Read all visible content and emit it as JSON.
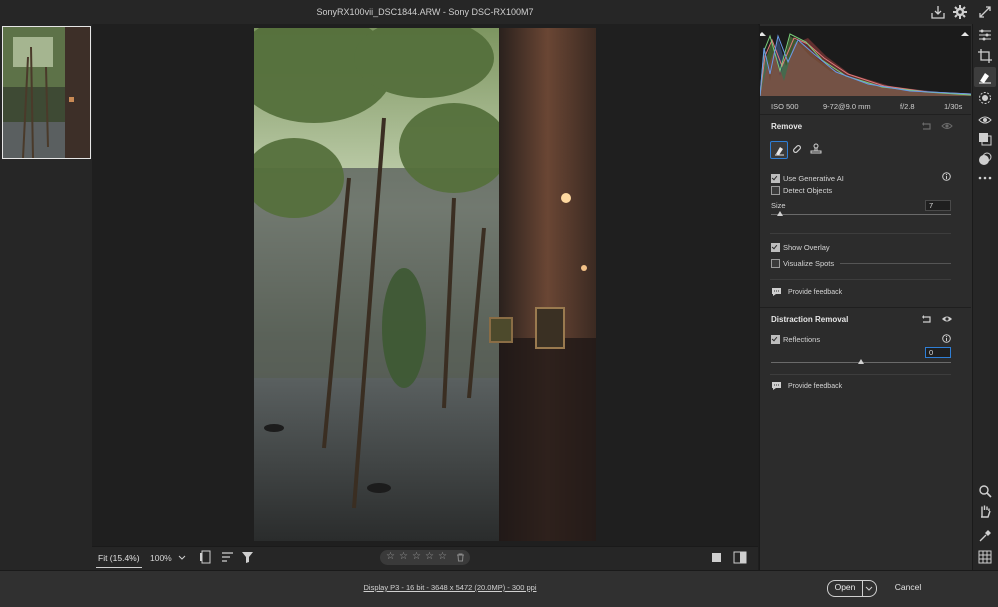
{
  "window": {
    "title": "SonyRX100vii_DSC1844.ARW  -  Sony DSC-RX100M7"
  },
  "canvas_toolbar": {
    "fit_label": "Fit (15.4%)",
    "zoom_label": "100%",
    "rating_stars": [
      "☆",
      "☆",
      "☆",
      "☆",
      "☆"
    ]
  },
  "footer": {
    "info": "Display P3 - 16 bit - 3648 x 5472 (20.0MP) - 300 ppi",
    "open_label": "Open",
    "cancel_label": "Cancel"
  },
  "exif": {
    "iso": "ISO 500",
    "lens": "9-72@9.0 mm",
    "aperture": "f/2.8",
    "shutter": "1/30s"
  },
  "remove_panel": {
    "title": "Remove",
    "use_generative_ai": {
      "label": "Use Generative AI",
      "checked": true
    },
    "detect_objects": {
      "label": "Detect Objects",
      "checked": false
    },
    "size_label": "Size",
    "size_value": "7",
    "size_fraction": 0.05,
    "show_overlay": {
      "label": "Show Overlay",
      "checked": true
    },
    "visualize_spots": {
      "label": "Visualize Spots",
      "checked": false
    },
    "feedback_label": "Provide feedback"
  },
  "distraction_panel": {
    "title": "Distraction Removal",
    "reflections": {
      "label": "Reflections",
      "checked": true
    },
    "reflections_value": "0",
    "reflections_fraction": 0.5,
    "feedback_label": "Provide feedback"
  },
  "colors": {
    "accent": "#2f7fd6",
    "panel_bg": "#2c2c2c",
    "canvas_bg": "#1f1f1f"
  }
}
